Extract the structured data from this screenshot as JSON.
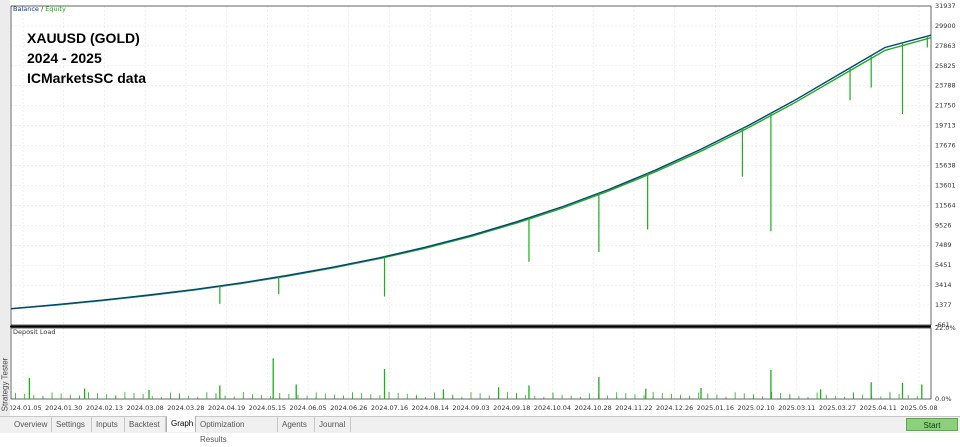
{
  "side_label": "Strategy Tester",
  "legend": {
    "balance": "Balance",
    "separator": " / ",
    "equity": "Equity"
  },
  "title_lines": [
    "XAUUSD (GOLD)",
    "2024 - 2025",
    "ICMarketsSC data"
  ],
  "colors": {
    "balance": "#0a3d8f",
    "equity": "#19b019",
    "load_bars": "#19b019",
    "axis": "#000000"
  },
  "chart_data": {
    "type": "line",
    "title": "XAUUSD (GOLD)",
    "y_ticks": [
      "31937",
      "29900",
      "27863",
      "25825",
      "23788",
      "21750",
      "19713",
      "17676",
      "15638",
      "13601",
      "11564",
      "9526",
      "7489",
      "5451",
      "3414",
      "1377",
      "-661"
    ],
    "ylim": [
      -661,
      31937
    ],
    "x_ticks": [
      "2024.01.05",
      "2024.01.30",
      "2024.02.13",
      "2024.03.08",
      "2024.03.28",
      "2024.04.19",
      "2024.05.15",
      "2024.06.05",
      "2024.06.26",
      "2024.07.16",
      "2024.08.14",
      "2024.09.03",
      "2024.09.18",
      "2024.10.04",
      "2024.10.28",
      "2024.11.22",
      "2024.12.26",
      "2025.01.16",
      "2025.02.10",
      "2025.03.11",
      "2025.03.27",
      "2025.04.11",
      "2025.05.08"
    ],
    "series": [
      {
        "name": "Balance",
        "x": [
          0,
          5,
          10,
          15,
          20,
          25,
          30,
          35,
          40,
          45,
          50,
          55,
          60,
          65,
          70,
          75,
          80,
          85,
          90,
          95,
          100
        ],
        "y": [
          1000,
          1420,
          1880,
          2400,
          2980,
          3640,
          4400,
          5250,
          6200,
          7280,
          8500,
          9900,
          11450,
          13200,
          15150,
          17300,
          19650,
          22200,
          24950,
          27700,
          28950
        ]
      },
      {
        "name": "Equity",
        "x": [
          0,
          5,
          10,
          15,
          20,
          25,
          30,
          35,
          40,
          45,
          50,
          55,
          60,
          65,
          70,
          75,
          80,
          85,
          90,
          95,
          100
        ],
        "y": [
          990,
          1380,
          1840,
          2350,
          2930,
          3580,
          4330,
          5170,
          6110,
          7180,
          8390,
          9770,
          11300,
          13040,
          14970,
          17100,
          19430,
          21950,
          24680,
          27400,
          28700
        ]
      }
    ],
    "equity_dips": [
      {
        "x": 22.7,
        "y": 1500
      },
      {
        "x": 29.1,
        "y": 2500
      },
      {
        "x": 40.6,
        "y": 2250
      },
      {
        "x": 56.3,
        "y": 5800
      },
      {
        "x": 63.9,
        "y": 6800
      },
      {
        "x": 69.2,
        "y": 9100
      },
      {
        "x": 79.5,
        "y": 14500
      },
      {
        "x": 82.6,
        "y": 8900
      },
      {
        "x": 91.2,
        "y": 22300
      },
      {
        "x": 93.5,
        "y": 23600
      },
      {
        "x": 96.9,
        "y": 20900
      },
      {
        "x": 99.6,
        "y": 27700
      }
    ],
    "deposit_load": {
      "label": "Deposit Load",
      "y_ticks": [
        "22.0%",
        "0.0%"
      ],
      "ylim": [
        0,
        22
      ],
      "spikes": [
        {
          "x": 2,
          "y": 6.5
        },
        {
          "x": 8,
          "y": 3.2
        },
        {
          "x": 15,
          "y": 2.8
        },
        {
          "x": 22.7,
          "y": 4.2
        },
        {
          "x": 28.5,
          "y": 12.6
        },
        {
          "x": 31,
          "y": 4.5
        },
        {
          "x": 40.6,
          "y": 9.3
        },
        {
          "x": 47,
          "y": 3.0
        },
        {
          "x": 53,
          "y": 3.6
        },
        {
          "x": 56.3,
          "y": 4.2
        },
        {
          "x": 63.9,
          "y": 6.8
        },
        {
          "x": 69,
          "y": 3.2
        },
        {
          "x": 75,
          "y": 3.4
        },
        {
          "x": 82.6,
          "y": 9.0
        },
        {
          "x": 88,
          "y": 3.0
        },
        {
          "x": 93.5,
          "y": 5.2
        },
        {
          "x": 96.9,
          "y": 5.0
        },
        {
          "x": 99,
          "y": 4.5
        }
      ]
    }
  },
  "tabs": [
    {
      "label": "Overview",
      "active": false
    },
    {
      "label": "Settings",
      "active": false
    },
    {
      "label": "Inputs",
      "active": false
    },
    {
      "label": "Backtest",
      "active": false
    },
    {
      "label": "Graph",
      "active": true
    },
    {
      "label": "Optimization Results",
      "active": false
    },
    {
      "label": "Agents",
      "active": false
    },
    {
      "label": "Journal",
      "active": false
    }
  ],
  "start_button": "Start"
}
